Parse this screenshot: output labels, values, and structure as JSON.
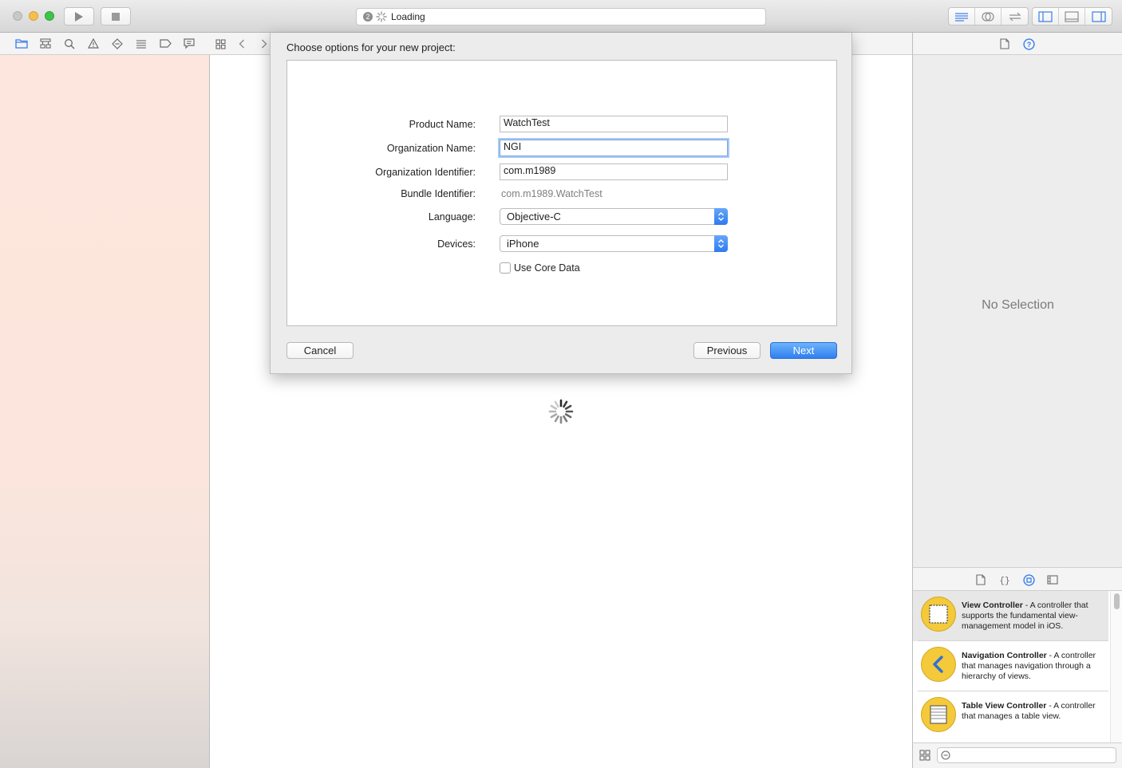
{
  "toolbar": {
    "activity_badge": "2",
    "activity_text": "Loading"
  },
  "sheet": {
    "title": "Choose options for your new project:",
    "fields": {
      "product_name_label": "Product Name:",
      "product_name_value": "WatchTest",
      "org_name_label": "Organization Name:",
      "org_name_value": "NGI",
      "org_id_label": "Organization Identifier:",
      "org_id_value": "com.m1989",
      "bundle_id_label": "Bundle Identifier:",
      "bundle_id_value": "com.m1989.WatchTest",
      "language_label": "Language:",
      "language_value": "Objective-C",
      "devices_label": "Devices:",
      "devices_value": "iPhone",
      "core_data_label": "Use Core Data",
      "core_data_checked": false
    },
    "buttons": {
      "cancel": "Cancel",
      "previous": "Previous",
      "next": "Next"
    }
  },
  "inspector": {
    "no_selection": "No Selection"
  },
  "library": {
    "items": [
      {
        "title": "View Controller",
        "desc": " - A controller that supports the fundamental view-management model in iOS.",
        "icon": "view-controller-icon"
      },
      {
        "title": "Navigation Controller",
        "desc": " - A controller that manages navigation through a hierarchy of views.",
        "icon": "navigation-controller-icon"
      },
      {
        "title": "Table View Controller",
        "desc": " - A controller that manages a table view.",
        "icon": "table-view-controller-icon"
      }
    ]
  },
  "colors": {
    "accent": "#2f7ff0",
    "library_icon": "#f4c93a"
  }
}
